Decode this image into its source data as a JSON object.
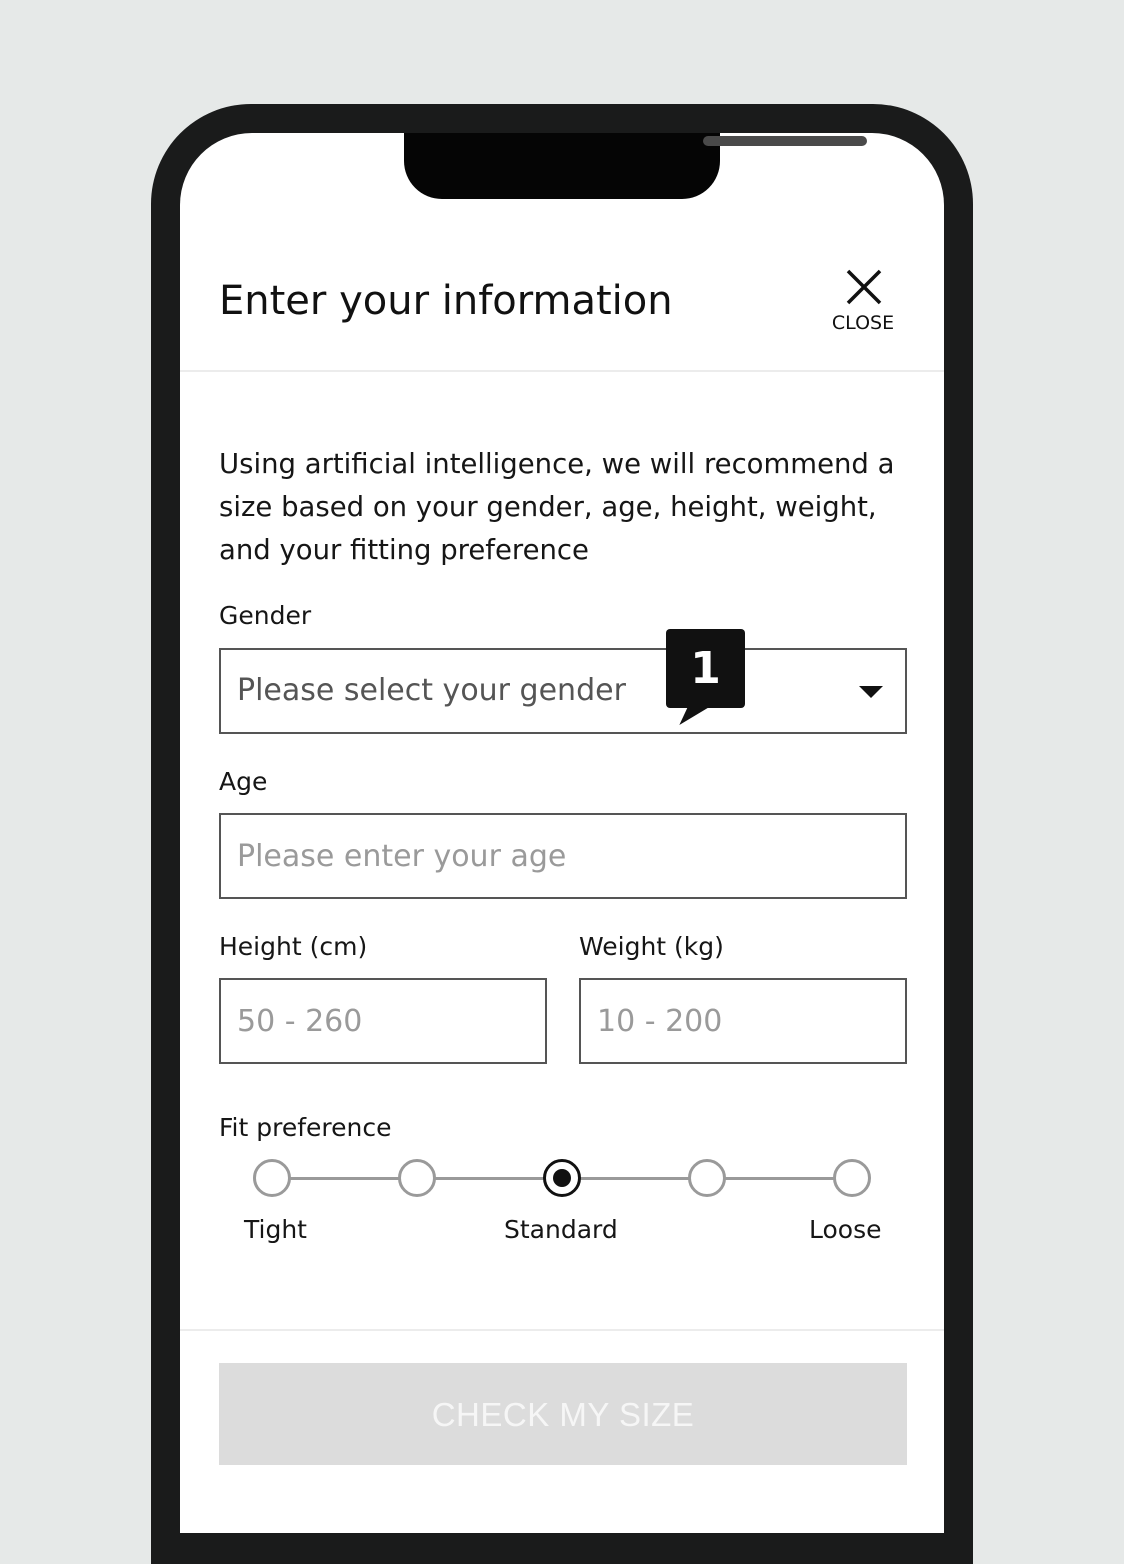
{
  "header": {
    "title": "Enter your information",
    "close_label": "CLOSE"
  },
  "intro_text": "Using artificial intelligence, we will recommend a size based on your gender, age, height, weight, and your fitting preference",
  "gender": {
    "label": "Gender",
    "placeholder": "Please select your gender",
    "step_badge": "1"
  },
  "age": {
    "label": "Age",
    "placeholder": "Please enter your age"
  },
  "height": {
    "label": "Height (cm)",
    "placeholder": "50 - 260"
  },
  "weight": {
    "label": "Weight (kg)",
    "placeholder": "10 - 200"
  },
  "fit": {
    "label": "Fit preference",
    "options_count": 5,
    "selected_index": 2,
    "labels": {
      "tight": "Tight",
      "standard": "Standard",
      "loose": "Loose"
    }
  },
  "submit": {
    "label": "CHECK MY SIZE"
  }
}
